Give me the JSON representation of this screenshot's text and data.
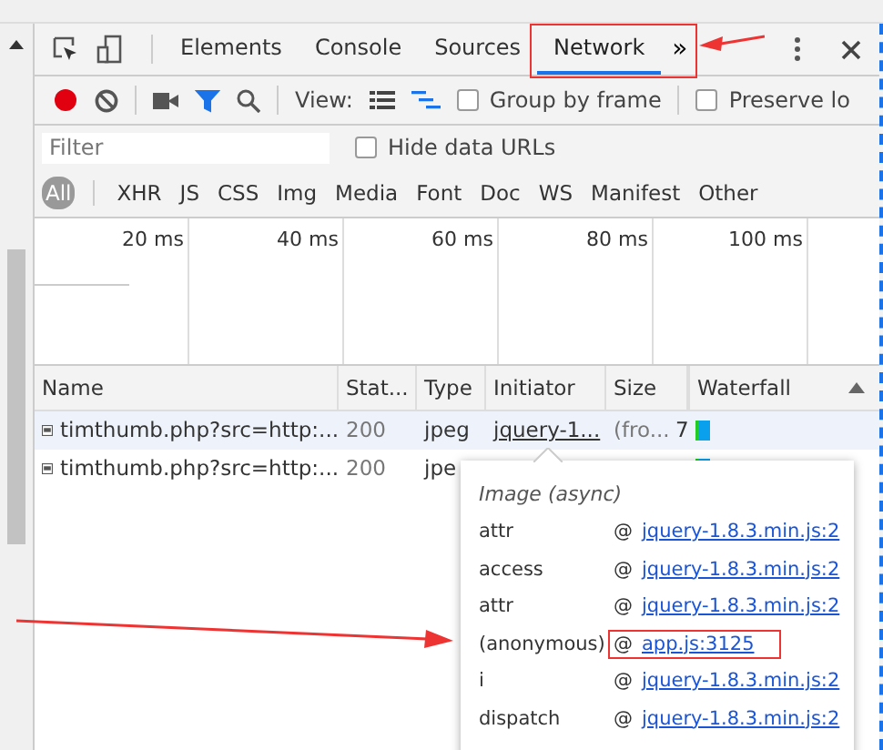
{
  "tabs": [
    {
      "label": "Elements",
      "selected": false
    },
    {
      "label": "Console",
      "selected": false
    },
    {
      "label": "Sources",
      "selected": false
    },
    {
      "label": "Network",
      "selected": true
    }
  ],
  "more_tabs": "»",
  "toolbar": {
    "recording": true,
    "view_label": "View:",
    "group_by_frame": {
      "label": "Group by frame",
      "checked": false
    },
    "preserve_log": {
      "label": "Preserve lo",
      "checked": false
    }
  },
  "filter": {
    "placeholder": "Filter",
    "hide_data_urls": {
      "label": "Hide data URLs",
      "checked": false
    }
  },
  "type_filters": [
    {
      "label": "All",
      "selected": true
    },
    {
      "label": "XHR",
      "selected": false
    },
    {
      "label": "JS",
      "selected": false
    },
    {
      "label": "CSS",
      "selected": false
    },
    {
      "label": "Img",
      "selected": false
    },
    {
      "label": "Media",
      "selected": false
    },
    {
      "label": "Font",
      "selected": false
    },
    {
      "label": "Doc",
      "selected": false
    },
    {
      "label": "WS",
      "selected": false
    },
    {
      "label": "Manifest",
      "selected": false
    },
    {
      "label": "Other",
      "selected": false
    }
  ],
  "overview_ticks": [
    "20 ms",
    "40 ms",
    "60 ms",
    "80 ms",
    "100 ms"
  ],
  "table": {
    "columns": [
      "Name",
      "Stat...",
      "Type",
      "Initiator",
      "Size",
      "Waterfall"
    ],
    "rows": [
      {
        "name": "timthumb.php?src=http:...",
        "status": "200",
        "type": "jpeg",
        "initiator": "jquery-1...",
        "size": "(fro...",
        "column_6": "7",
        "selected": true
      },
      {
        "name": "timthumb.php?src=http:...",
        "status": "200",
        "type": "jpe",
        "selected": false
      }
    ]
  },
  "popover": {
    "title": "Image (async)",
    "frames": [
      {
        "function": "attr",
        "at": "@",
        "location": "jquery-1.8.3.min.js:2",
        "highlighted": false
      },
      {
        "function": "access",
        "at": "@",
        "location": "jquery-1.8.3.min.js:2",
        "highlighted": false
      },
      {
        "function": "attr",
        "at": "@",
        "location": "jquery-1.8.3.min.js:2",
        "highlighted": false
      },
      {
        "function": "(anonymous)",
        "at": "@",
        "location": "app.js:3125",
        "highlighted": true
      },
      {
        "function": "i",
        "at": "@",
        "location": "jquery-1.8.3.min.js:2",
        "highlighted": false
      },
      {
        "function": "dispatch",
        "at": "@",
        "location": "jquery-1.8.3.min.js:2",
        "highlighted": false
      }
    ]
  }
}
